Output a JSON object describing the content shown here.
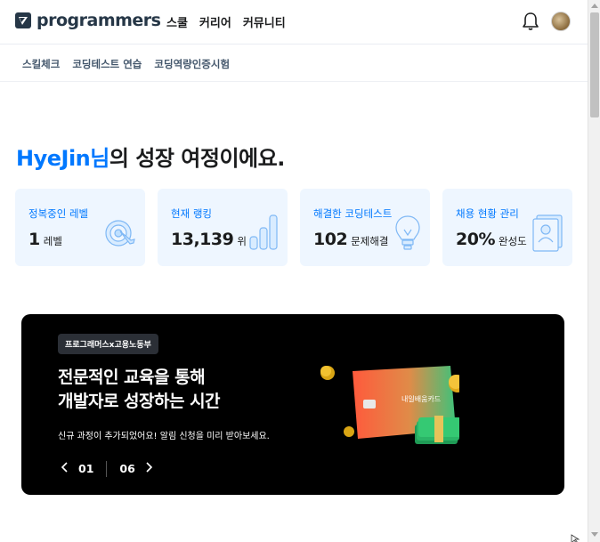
{
  "brand": {
    "name": "programmers"
  },
  "nav": {
    "menu": [
      "스쿨",
      "커리어",
      "커뮤니티"
    ]
  },
  "subnav": {
    "items": [
      "스킬체크",
      "코딩테스트 연습",
      "코딩역량인증시험"
    ]
  },
  "greeting": {
    "username": "HyeJin님",
    "text": "의 성장 여정이에요."
  },
  "stats": [
    {
      "label": "정복중인 레벨",
      "value": "1",
      "unit": "레벨",
      "icon": "target-icon"
    },
    {
      "label": "현재 랭킹",
      "value": "13,139",
      "unit": "위",
      "icon": "bar-chart-icon"
    },
    {
      "label": "해결한 코딩테스트",
      "value": "102",
      "unit": "문제해결",
      "icon": "lightbulb-icon"
    },
    {
      "label": "채용 현황 관리",
      "value": "20%",
      "unit": "완성도",
      "icon": "resume-icon"
    }
  ],
  "banner": {
    "badge": "프로그래머스x고용노동부",
    "headline_line1": "전문적인 교육을 통해",
    "headline_line2": "개발자로 성장하는 시간",
    "subtitle": "신규 과정이 추가되었어요! 알림 신청을 미리 받아보세요.",
    "card_text": "내일배움카드",
    "current_page": "01",
    "total_pages": "06"
  },
  "colors": {
    "accent": "#0078ff",
    "card_bg": "#eef6ff",
    "banner_bg": "#000000",
    "text": "#1b1c1d"
  }
}
